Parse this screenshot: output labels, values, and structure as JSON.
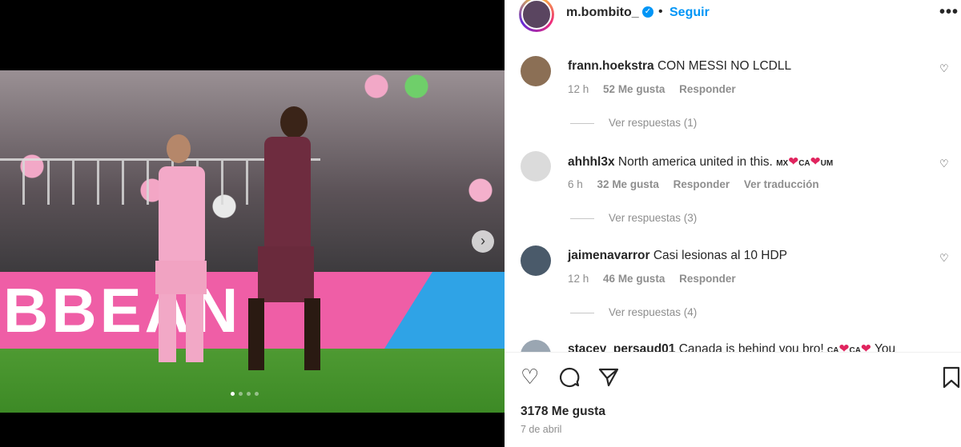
{
  "post": {
    "username": "m.bombito_",
    "verified_icon": "verified-badge-icon",
    "separator": "•",
    "follow_label": "Seguir",
    "more_label": "•••",
    "media": {
      "banner_text": "BBEAN",
      "next_icon": "chevron-right-icon",
      "carousel_total": 4,
      "carousel_active": 1
    }
  },
  "comments": [
    {
      "username": "frann.hoekstra",
      "text": "CON MESSI NO LCDLL",
      "time": "12 h",
      "likes": "52 Me gusta",
      "reply_label": "Responder",
      "translate_label": "",
      "replies_label": "Ver respuestas (1)"
    },
    {
      "username": "ahhhl3x",
      "text": "North america united in this.",
      "flags": [
        "MX",
        "CA",
        "UM"
      ],
      "time": "6 h",
      "likes": "32 Me gusta",
      "reply_label": "Responder",
      "translate_label": "Ver traducción",
      "replies_label": "Ver respuestas (3)"
    },
    {
      "username": "jaimenavarror",
      "text": "Casi lesionas al 10 HDP",
      "time": "12 h",
      "likes": "46 Me gusta",
      "reply_label": "Responder",
      "translate_label": "",
      "replies_label": "Ver respuestas (4)"
    },
    {
      "username": "stacey_persaud01",
      "text": "Canada is behind you bro!",
      "flags": [
        "CA",
        "CA"
      ],
      "trailing": "You"
    }
  ],
  "actions": {
    "like_icon": "heart-outline-icon",
    "comment_icon": "comment-bubble-icon",
    "share_icon": "paper-plane-icon",
    "save_icon": "bookmark-icon"
  },
  "footer": {
    "likes": "3178 Me gusta",
    "date": "7 de abril"
  },
  "colors": {
    "accent": "#0095f6",
    "banner_pink": "#ef5ea6",
    "banner_blue": "#2fa3e6",
    "heart_red": "#e0245e"
  }
}
